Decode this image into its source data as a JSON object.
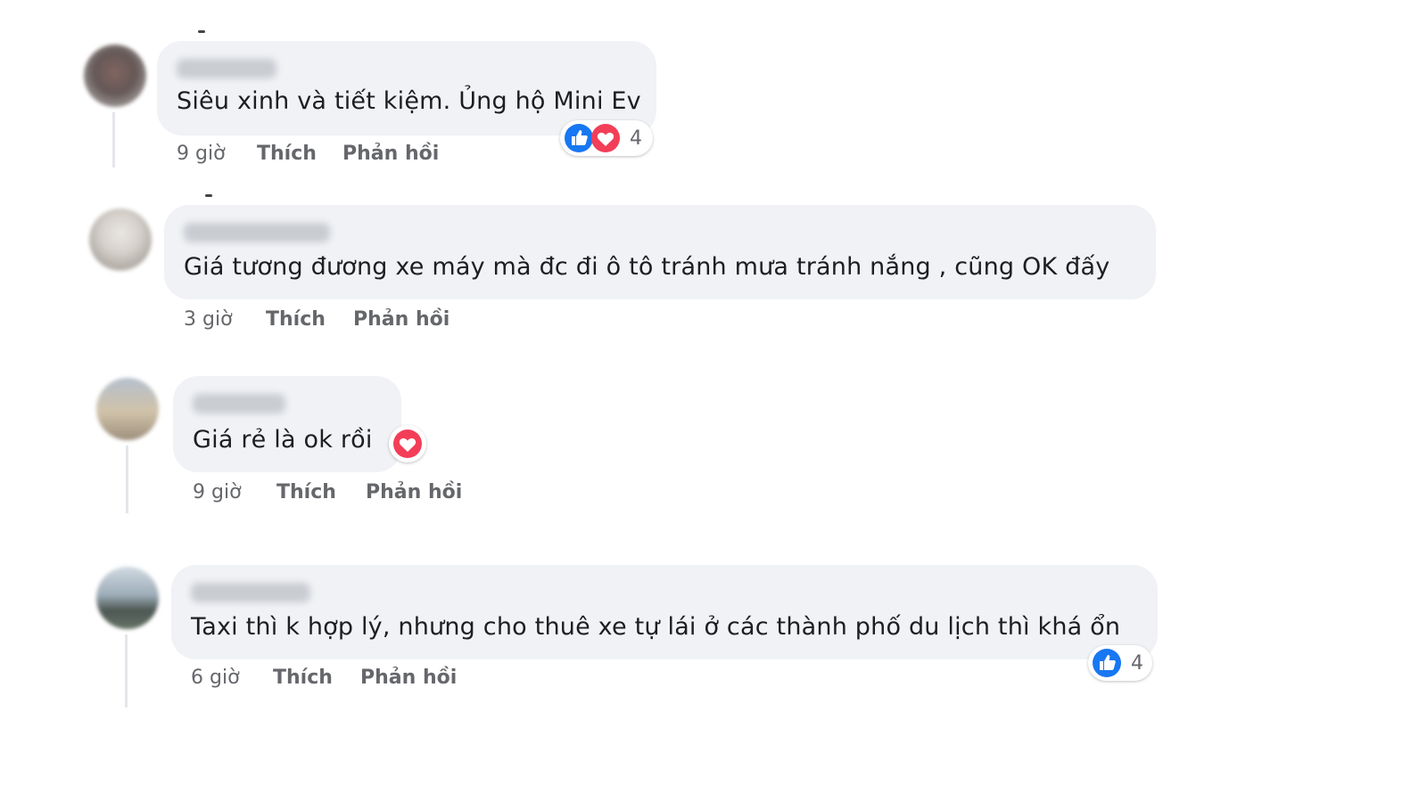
{
  "colors": {
    "bubble": "#f0f2f5",
    "like": "#1877f2",
    "love": "#f33e58",
    "meta_text": "#65676b"
  },
  "comments": [
    {
      "text": "Siêu xinh và tiết kiệm. Ủng hộ Mini Ev",
      "time": "9 giờ",
      "like_label": "Thích",
      "reply_label": "Phản hồi",
      "reactions": [
        "like-icon",
        "love-icon"
      ],
      "reaction_count": "4"
    },
    {
      "text": "Giá tương đương xe máy mà đc đi ô tô tránh mưa tránh nắng , cũng OK đấy",
      "time": "3 giờ",
      "like_label": "Thích",
      "reply_label": "Phản hồi"
    },
    {
      "text": "Giá rẻ là ok rồi",
      "time": "9 giờ",
      "like_label": "Thích",
      "reply_label": "Phản hồi",
      "reactions": [
        "love-icon"
      ]
    },
    {
      "text": "Taxi thì k hợp lý, nhưng cho thuê xe tự lái ở các thành phố du lịch thì khá ổn",
      "time": "6 giờ",
      "like_label": "Thích",
      "reply_label": "Phản hồi",
      "reactions": [
        "like-icon"
      ],
      "reaction_count": "4"
    }
  ]
}
